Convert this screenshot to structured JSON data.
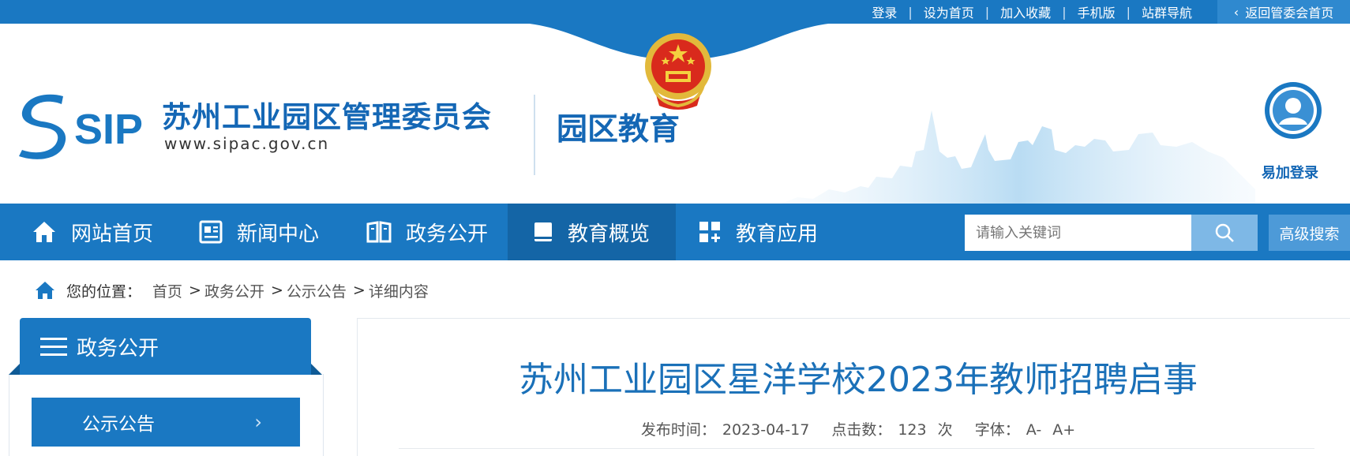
{
  "topbar": {
    "links": [
      "登录",
      "设为首页",
      "加入收藏",
      "手机版",
      "站群导航"
    ],
    "back_label": "返回管委会首页"
  },
  "header": {
    "logo_text": "SIP",
    "org_name": "苏州工业园区管理委员会",
    "org_url": "www.sipac.gov.cn",
    "site_title": "园区教育",
    "login_label": "易加登录"
  },
  "nav": {
    "items": [
      {
        "label": "网站首页",
        "icon": "home-icon"
      },
      {
        "label": "新闻中心",
        "icon": "news-icon"
      },
      {
        "label": "政务公开",
        "icon": "book-open-icon"
      },
      {
        "label": "教育概览",
        "icon": "book-icon"
      },
      {
        "label": "教育应用",
        "icon": "apps-icon"
      }
    ],
    "active_index": 3,
    "search_placeholder": "请输入关键词",
    "advanced_search_label": "高级搜索"
  },
  "breadcrumb": {
    "prefix": "您的位置：",
    "items": [
      "首页",
      "政务公开",
      "公示公告",
      "详细内容"
    ]
  },
  "sidebar": {
    "title": "政务公开",
    "items": [
      "公示公告"
    ]
  },
  "article": {
    "title": "苏州工业园区星洋学校2023年教师招聘启事",
    "date_label": "发布时间：",
    "date": "2023-04-17",
    "clicks_label": "点击数：",
    "clicks": "123",
    "clicks_unit": "次",
    "font_label": "字体：",
    "font_smaller": "A-",
    "font_larger": "A+"
  },
  "colors": {
    "primary": "#1a78c2",
    "title_blue": "#1a70b8",
    "dark_blue": "#1467b5"
  }
}
